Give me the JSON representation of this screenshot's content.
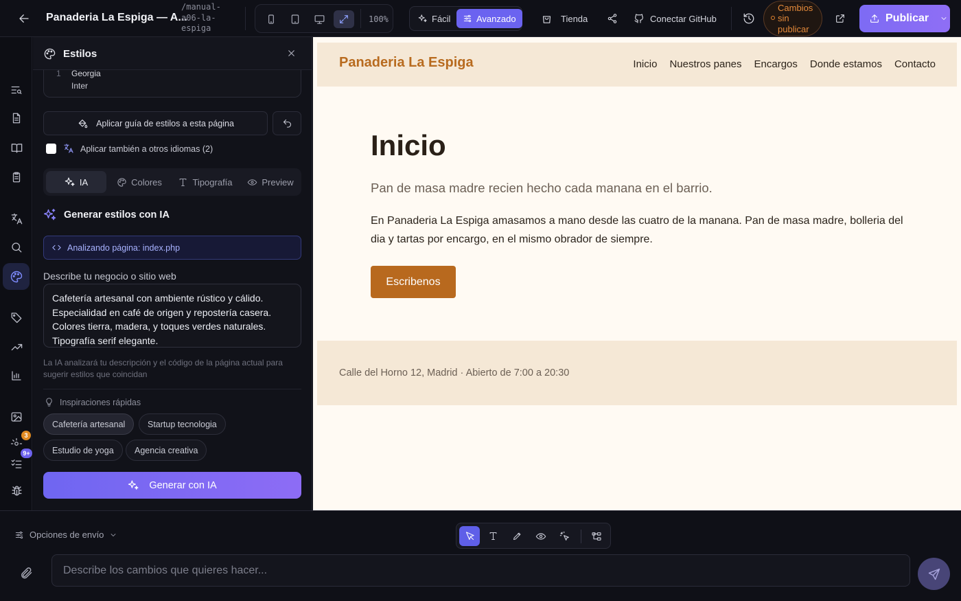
{
  "topbar": {
    "project_title": "Panaderia La Espiga — A...",
    "project_path": "/manual-a06-la-espiga",
    "zoom": "100%",
    "mode_easy": "Fácil",
    "mode_advanced": "Avanzado",
    "store": "Tienda",
    "connect_github": "Conectar GitHub",
    "unpublished": "Cambios sin publicar",
    "publish": "Publicar"
  },
  "rail": {
    "badge_orange": "3",
    "badge_purple": "9+"
  },
  "styles_panel": {
    "title": "Estilos",
    "fonts": [
      "Georgia",
      "Inter"
    ],
    "font_index": "1",
    "apply_button": "Aplicar guía de estilos a esta página",
    "apply_other_langs": "Aplicar también a otros idiomas (2)",
    "tabs": [
      "IA",
      "Colores",
      "Tipografía",
      "Preview"
    ],
    "generate_heading": "Generar estilos con IA",
    "analyzing": "Analizando página: index.php",
    "describe_label": "Describe tu negocio o sitio web",
    "describe_value": "Cafetería artesanal con ambiente rústico y cálido. Especialidad en café de origen y repostería casera. Colores tierra, madera, y toques verdes naturales. Tipografía serif elegante.",
    "hint": "La IA analizará tu descripción y el código de la página actual para sugerir estilos que coincidan",
    "inspirations_label": "Inspiraciones rápidas",
    "inspirations": [
      "Cafetería artesanal",
      "Startup tecnologia",
      "Estudio de yoga",
      "Agencia creativa"
    ],
    "generate_button": "Generar con IA"
  },
  "preview": {
    "brand": "Panaderia La Espiga",
    "nav": [
      "Inicio",
      "Nuestros panes",
      "Encargos",
      "Donde estamos",
      "Contacto"
    ],
    "hero_title": "Inicio",
    "hero_subtitle": "Pan de masa madre recien hecho cada manana en el barrio.",
    "hero_body": "En Panaderia La Espiga amasamos a mano desde las cuatro de la manana. Pan de masa madre, bolleria del dia y tartas por encargo, en el mismo obrador de siempre.",
    "cta": "Escribenos",
    "footer": "Calle del Horno 12, Madrid · Abierto de 7:00 a 20:30"
  },
  "chat": {
    "send_options": "Opciones de envío",
    "placeholder": "Describe los cambios que quieres hacer..."
  },
  "colors": {
    "accent": "#6b63f0",
    "unpublished": "#e58a3a",
    "brand": "#b86b1f",
    "preview_bg": "#fffaf3",
    "preview_band": "#f5e8d6"
  }
}
